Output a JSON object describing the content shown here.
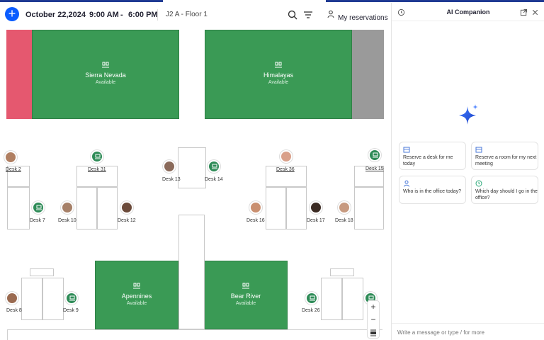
{
  "header": {
    "date": "October 22,2024",
    "start_time": "9:00 AM",
    "dash": "-",
    "end_time": "6:00 PM",
    "location": "J2 A - Floor 1",
    "my_reservations": "My reservations"
  },
  "map": {
    "rooms": [
      {
        "name": "Sierra Nevada",
        "status": "Available"
      },
      {
        "name": "Himalayas",
        "status": "Available"
      },
      {
        "name": "Apennines",
        "status": "Available"
      },
      {
        "name": "Bear River",
        "status": "Available"
      }
    ],
    "desks": {
      "d2": "Desk 2",
      "d31": "Desk 31",
      "d13": "Desk 13",
      "d14": "Desk 14",
      "d36": "Desk 36",
      "d15": "Desk 15",
      "d7": "Desk 7",
      "d10": "Desk 10",
      "d12": "Desk 12",
      "d16": "Desk 16",
      "d17": "Desk 17",
      "d18": "Desk 18",
      "d8": "Desk 8",
      "d9": "Desk 9",
      "d26": "Desk 26"
    },
    "zoom": {
      "plus": "+",
      "minus": "−"
    }
  },
  "panel": {
    "title": "AI Companion",
    "suggestions": [
      {
        "icon": "calendar-icon",
        "text": "Reserve a desk for me today"
      },
      {
        "icon": "calendar-icon",
        "text": "Reserve a room for my next meeting"
      },
      {
        "icon": "person-icon",
        "text": "Who is in the office today?"
      },
      {
        "icon": "clock-icon",
        "text": "Which day should I go in the office?"
      }
    ],
    "composer_placeholder": "Write a message or type / for more"
  },
  "colors": {
    "accent": "#0b5cff",
    "room_available": "#3a9a55",
    "wall_pink": "#e5586f",
    "wall_gray": "#9a9a9a"
  }
}
